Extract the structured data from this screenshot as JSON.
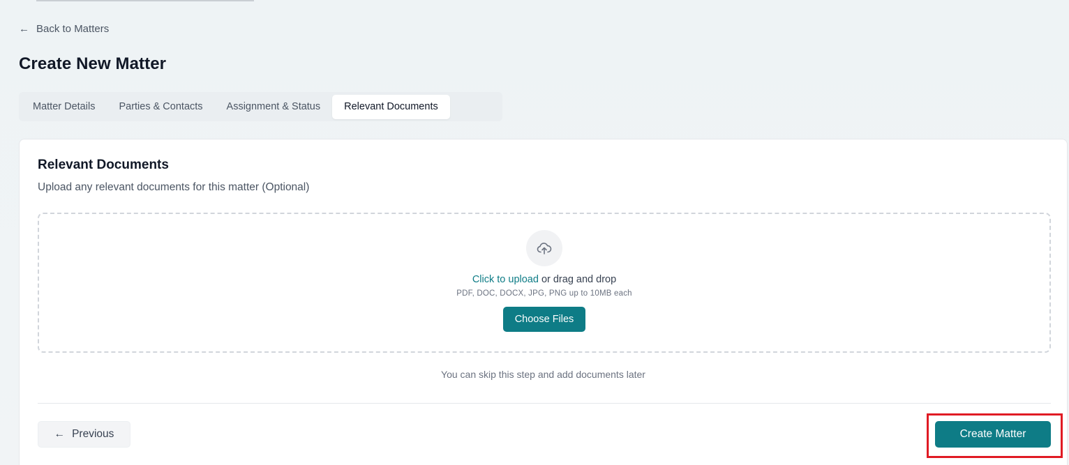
{
  "nav": {
    "back_label": "Back to Matters",
    "back_icon": "arrow-left-icon"
  },
  "page": {
    "title": "Create New Matter"
  },
  "tabs": [
    {
      "label": "Matter Details",
      "active": false
    },
    {
      "label": "Parties & Contacts",
      "active": false
    },
    {
      "label": "Assignment & Status",
      "active": false
    },
    {
      "label": "Relevant Documents",
      "active": true
    }
  ],
  "documents": {
    "title": "Relevant Documents",
    "subtitle": "Upload any relevant documents for this matter (Optional)",
    "upload_icon": "cloud-upload-icon",
    "upload_link": "Click to upload",
    "upload_rest": " or drag and drop",
    "formats": "PDF, DOC, DOCX, JPG, PNG up to 10MB each",
    "choose_label": "Choose Files",
    "skip_note": "You can skip this step and add documents later"
  },
  "footer": {
    "previous_label": "Previous",
    "create_label": "Create Matter"
  },
  "colors": {
    "accent": "#0e7c86",
    "highlight": "#e01b24"
  }
}
